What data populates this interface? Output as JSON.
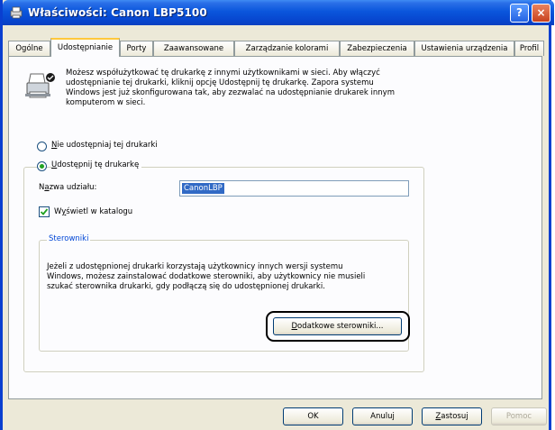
{
  "window": {
    "title": "Właściwości: Canon LBP5100",
    "help_label": "?",
    "close_label": "×"
  },
  "tabs": [
    {
      "label": "Ogólne"
    },
    {
      "label": "Udostępnianie"
    },
    {
      "label": "Porty"
    },
    {
      "label": "Zaawansowane"
    },
    {
      "label": "Zarządzanie kolorami"
    },
    {
      "label": "Zabezpieczenia"
    },
    {
      "label": "Ustawienia urządzenia"
    },
    {
      "label": "Profil"
    }
  ],
  "sharing": {
    "description": [
      "Możesz współużytkować tę drukarkę z innymi użytkownikami w sieci. Aby włączyć",
      "udostępnianie tej drukarki, kliknij opcję Udostępnij tę drukarkę.  Zapora systemu",
      "Windows jest już skonfigurowana tak, aby zezwalać na udostępnianie drukarek innym",
      "komputerom w sieci."
    ],
    "radio_no_share": {
      "key": "N",
      "rest": "ie udostępniaj tej drukarki",
      "selected": false
    },
    "radio_share": {
      "key": "U",
      "rest": "dostępnij tę drukarkę",
      "selected": true
    },
    "share_name": {
      "label_pre": "N",
      "label_key": "a",
      "label_post": "zwa udziału:",
      "value": "CanonLBP"
    },
    "list_in_directory": {
      "pre": "W",
      "key": "y",
      "post": "świetl w katalogu",
      "checked": true
    },
    "drivers": {
      "group_label": "Sterowniki",
      "description": [
        "Jeżeli z udostępnionej drukarki korzystają użytkownicy innych wersji systemu",
        "Windows, możesz zainstalować dodatkowe sterowniki, aby użytkownicy nie musieli",
        "szukać sterownika drukarki, gdy podłączą się do udostępnionej drukarki."
      ],
      "button": {
        "key": "D",
        "rest": "odatkowe sterowniki..."
      }
    }
  },
  "footer": {
    "ok": "OK",
    "cancel": "Anuluj",
    "apply": {
      "key": "Z",
      "rest": "astosuj"
    },
    "help": "Pomoc"
  },
  "colors": {
    "title_bar": "#0a56dc",
    "accent_tab": "#ffc83c",
    "group_label": "#0046d5"
  }
}
